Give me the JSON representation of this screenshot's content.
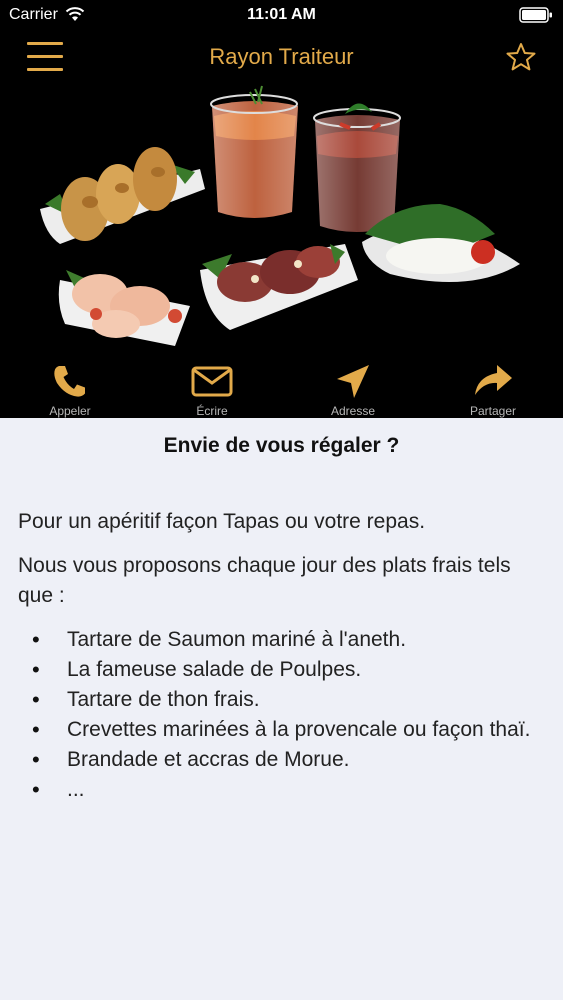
{
  "status": {
    "carrier": "Carrier",
    "time": "11:01 AM"
  },
  "nav": {
    "title": "Rayon Traiteur"
  },
  "icons": {
    "menu": "hamburger-menu-icon",
    "favorite": "star-icon",
    "call": "phone-icon",
    "write": "envelope-icon",
    "address": "location-arrow-icon",
    "share": "share-arrow-icon"
  },
  "colors": {
    "accent": "#e2aa4a",
    "hero_background": "#000000",
    "content_background": "#eef0f7"
  },
  "actions": [
    {
      "label": "Appeler"
    },
    {
      "label": "Écrire"
    },
    {
      "label": "Adresse"
    },
    {
      "label": "Partager"
    }
  ],
  "content": {
    "headline": "Envie de vous régaler ?",
    "paragraph1": "Pour un apéritif façon Tapas ou votre repas.",
    "paragraph2": "Nous vous proposons chaque jour des plats frais tels que :",
    "items": [
      "Tartare de Saumon mariné à l'aneth.",
      "La fameuse salade de Poulpes.",
      "Tartare de thon frais.",
      "Crevettes marinées à la provencale ou façon thaï.",
      "Brandade et accras de Morue.",
      "..."
    ]
  }
}
